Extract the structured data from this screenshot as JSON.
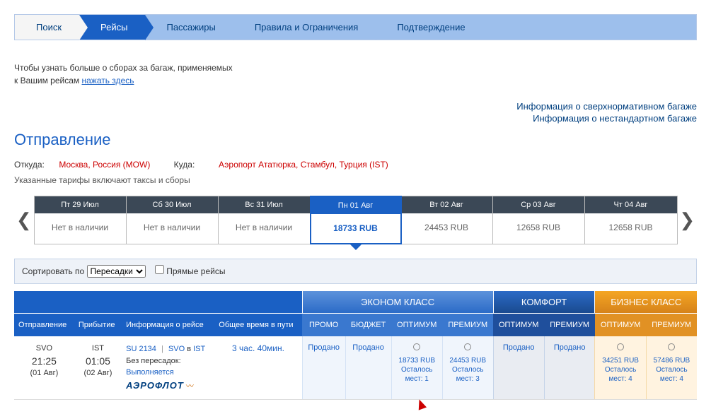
{
  "steps": {
    "search": "Поиск",
    "flights": "Рейсы",
    "passengers": "Пассажиры",
    "rules": "Правила и Ограничения",
    "confirm": "Подтверждение"
  },
  "baggage_note": {
    "line1": "Чтобы узнать больше о сборах за багаж, применяемых",
    "line2_prefix": "к Вашим рейсам ",
    "link": "нажать здесь"
  },
  "info_links": {
    "oversize": "Информация о сверхнормативном багаже",
    "nonstd": "Информация о нестандартном багаже"
  },
  "departure": {
    "title": "Отправление",
    "from_lbl": "Откуда:",
    "from_val": "Москва, Россия (MOW)",
    "to_lbl": "Куда:",
    "to_val": "Аэропорт Ататюрка, Стамбул, Турция (IST)",
    "fare_note": "Указанные тарифы включают таксы и сборы"
  },
  "days": [
    {
      "label": "Пт 29 Июл",
      "value": "Нет в наличии",
      "selected": false
    },
    {
      "label": "Сб 30 Июл",
      "value": "Нет в наличии",
      "selected": false
    },
    {
      "label": "Вс 31 Июл",
      "value": "Нет в наличии",
      "selected": false
    },
    {
      "label": "Пн 01 Авг",
      "value": "18733 RUB",
      "selected": true
    },
    {
      "label": "Вт 02 Авг",
      "value": "24453 RUB",
      "selected": false
    },
    {
      "label": "Ср 03 Авг",
      "value": "12658 RUB",
      "selected": false
    },
    {
      "label": "Чт 04 Авг",
      "value": "12658 RUB",
      "selected": false
    }
  ],
  "sort": {
    "label": "Сортировать по",
    "selected": "Пересадки",
    "direct_label": "Прямые рейсы"
  },
  "classes": {
    "econ": "ЭКОНОМ КЛАСС",
    "comfort": "КОМФОРТ",
    "biz": "БИЗНЕС КЛАСС"
  },
  "cols": {
    "dep": "Отправление",
    "arr": "Прибытие",
    "info": "Информация о рейсе",
    "dur": "Общее время в пути",
    "promo": "ПРОМО",
    "budget": "БЮДЖЕТ",
    "optimum": "ОПТИМУМ",
    "premium": "ПРЕМИУМ"
  },
  "flight": {
    "dep_code": "SVO",
    "dep_time": "21:25",
    "dep_date": "(01 Авг)",
    "arr_code": "IST",
    "arr_time": "01:05",
    "arr_date": "(02 Авг)",
    "number": "SU 2134",
    "route_from": "SVO",
    "route_dir": "в",
    "route_to": "IST",
    "stops": "Без пересадок:",
    "operated": "Выполняется",
    "airline": "АЭРОФЛОТ",
    "duration": "3 час. 40мин.",
    "fares": {
      "promo": "Продано",
      "budget": "Продано",
      "optimum": {
        "price": "18733 RUB",
        "remain_lbl": "Осталось",
        "remain_val": "мест: 1"
      },
      "premium": {
        "price": "24453 RUB",
        "remain_lbl": "Осталось",
        "remain_val": "мест: 3"
      },
      "comf_opt": "Продано",
      "comf_prem": "Продано",
      "biz_opt": {
        "price": "34251 RUB",
        "remain_lbl": "Осталось",
        "remain_val": "мест: 4"
      },
      "biz_prem": {
        "price": "57486 RUB",
        "remain_lbl": "Осталось",
        "remain_val": "мест: 4"
      }
    }
  }
}
